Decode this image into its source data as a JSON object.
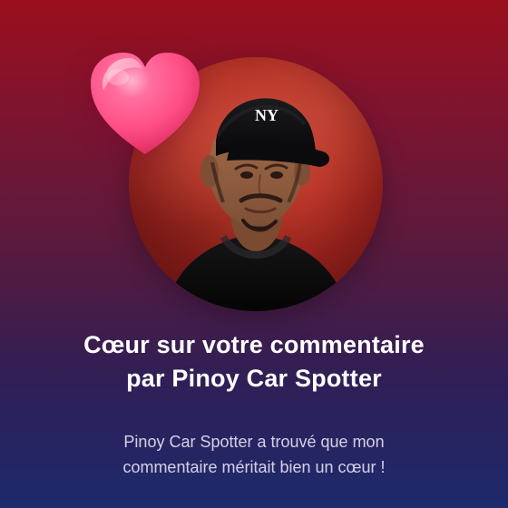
{
  "notification": {
    "title_line1": "Cœur sur votre commentaire",
    "title_line2": "par Pinoy Car Spotter",
    "subtitle_line1": "Pinoy Car Spotter a trouvé que mon",
    "subtitle_line2": "commentaire méritait bien un cœur !"
  },
  "avatar": {
    "cap_logo_text": "NY"
  },
  "colors": {
    "background_top": "#9a0f1c",
    "background_bottom": "#1d2a6d",
    "heart": "#ff4f86",
    "title_text": "#ffffff",
    "subtitle_text": "#ece4f4",
    "profile_background": "#b73427"
  },
  "icons": {
    "heart": "heart-icon",
    "avatar": "profile-avatar"
  }
}
